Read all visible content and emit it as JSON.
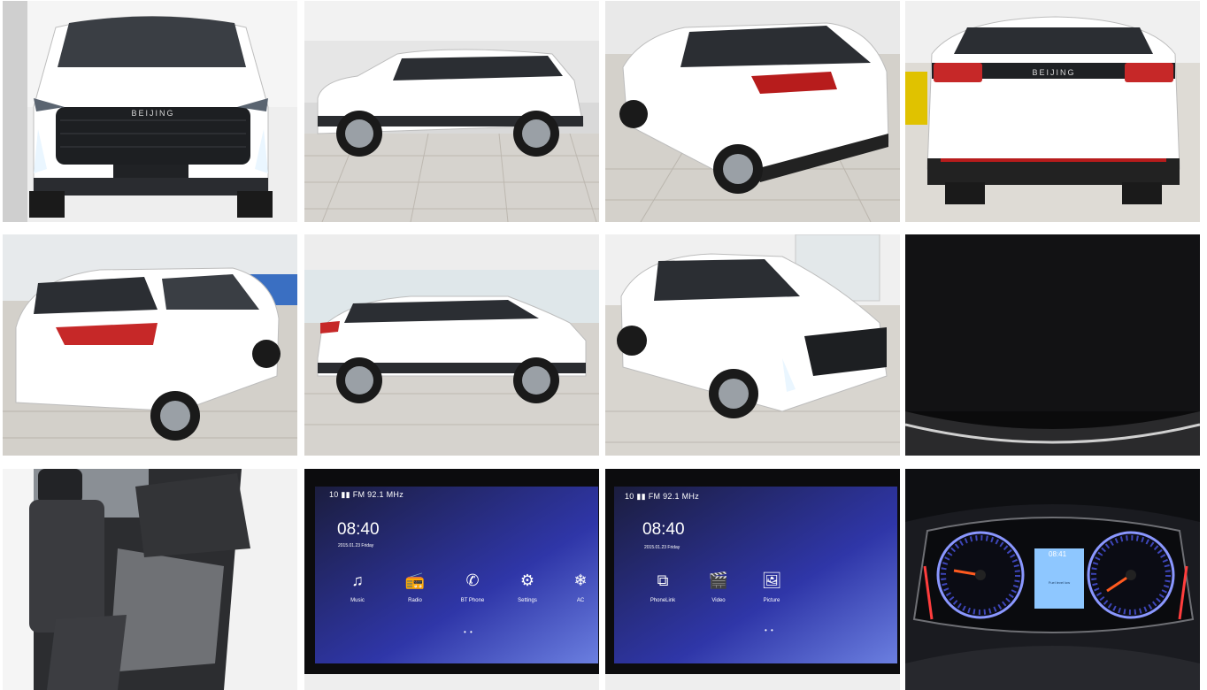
{
  "gallery": {
    "brand_badge": "BEIJING",
    "screen1": {
      "status": "10 ▮▮ FM 92.1 MHz",
      "time": "08:40",
      "date": "2015.01.23 Friday",
      "apps": [
        {
          "glyph": "♫",
          "label": "Music"
        },
        {
          "glyph": "📻",
          "label": "Radio"
        },
        {
          "glyph": "✆",
          "label": "BT Phone"
        },
        {
          "glyph": "⚙",
          "label": "Settings"
        },
        {
          "glyph": "❄",
          "label": "AC"
        }
      ],
      "pager": "• •"
    },
    "screen2": {
      "status": "10 ▮▮ FM 92.1 MHz",
      "time": "08:40",
      "date": "2015.01.23 Friday",
      "apps": [
        {
          "glyph": "⧉",
          "label": "PhoneLink"
        },
        {
          "glyph": "🎬",
          "label": "Video"
        },
        {
          "glyph": "🖼",
          "label": "Picture"
        }
      ],
      "pager": "• •"
    },
    "cluster": {
      "time": "08:41",
      "message": "Fuel level low"
    }
  }
}
